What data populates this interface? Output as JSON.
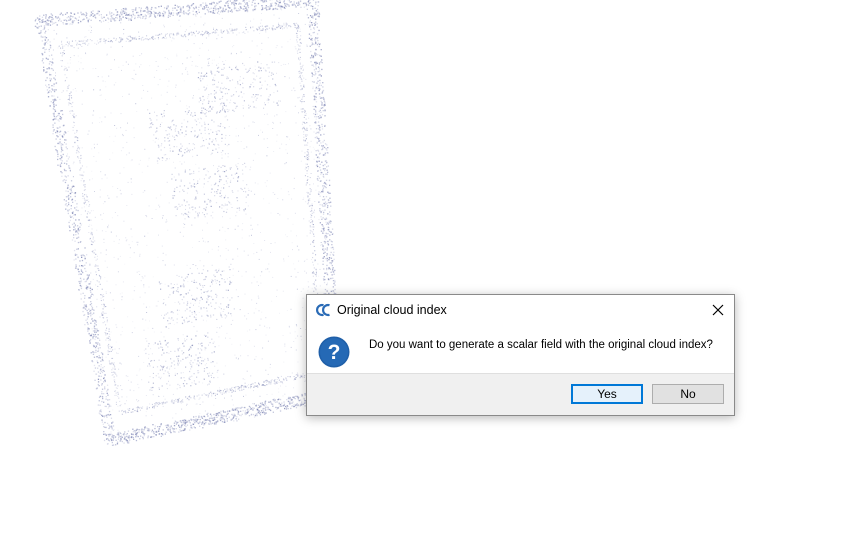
{
  "dialog": {
    "title": "Original cloud index",
    "app_icon": "cloudcompare-cc-icon",
    "close_icon": "close-icon",
    "message": "Do you want to generate a scalar field with the original cloud index?",
    "message_icon": "question-icon",
    "buttons": {
      "yes_label": "Yes",
      "no_label": "No"
    }
  },
  "colors": {
    "accent": "#0078d7",
    "question_icon": "#1f5fa8",
    "button_bar": "#f0f0f0",
    "point_cloud": "#9aa0c4"
  }
}
